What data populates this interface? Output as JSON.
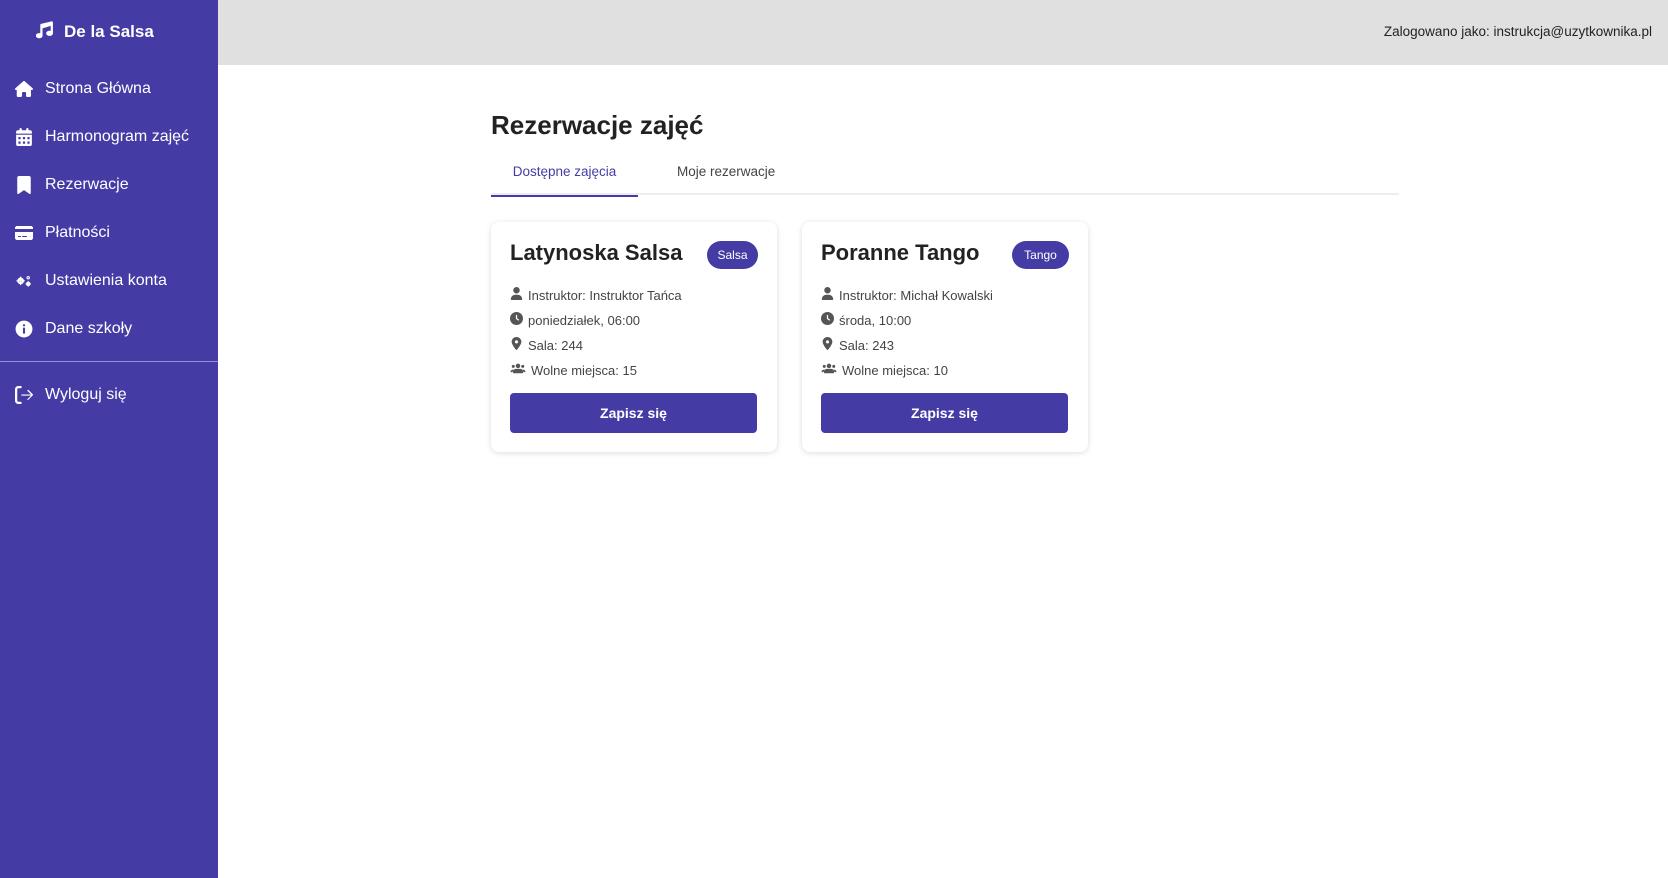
{
  "brand": {
    "name": "De la Salsa",
    "icon": "music-note-icon"
  },
  "sidebar": {
    "items": [
      {
        "label": "Strona Główna",
        "icon": "home-icon"
      },
      {
        "label": "Harmonogram zajęć",
        "icon": "calendar-icon"
      },
      {
        "label": "Rezerwacje",
        "icon": "bookmark-icon"
      },
      {
        "label": "Płatności",
        "icon": "credit-card-icon"
      },
      {
        "label": "Ustawienia konta",
        "icon": "gears-icon"
      },
      {
        "label": "Dane szkoły",
        "icon": "info-icon"
      }
    ],
    "logout": {
      "label": "Wyloguj się",
      "icon": "sign-out-icon"
    }
  },
  "header": {
    "user_info": "Zalogowano jako: instrukcja@uzytkownika.pl"
  },
  "main": {
    "title": "Rezerwacje zajęć",
    "tabs": [
      {
        "label": "Dostępne zajęcia",
        "active": true
      },
      {
        "label": "Moje rezerwacje",
        "active": false
      }
    ],
    "cards": [
      {
        "title": "Latynoska Salsa",
        "badge": "Salsa",
        "instructor": "Instruktor: Instruktor Tańca",
        "time": "poniedziałek, 06:00",
        "room": "Sala: 244",
        "spots": "Wolne miejsca: 15",
        "button": "Zapisz się"
      },
      {
        "title": "Poranne Tango",
        "badge": "Tango",
        "instructor": "Instruktor: Michał Kowalski",
        "time": "środa, 10:00",
        "room": "Sala: 243",
        "spots": "Wolne miejsca: 10",
        "button": "Zapisz się"
      }
    ]
  },
  "colors": {
    "accent": "#443ca4",
    "header_bg": "#e0e0e0",
    "page_bg": "#ffffff"
  }
}
